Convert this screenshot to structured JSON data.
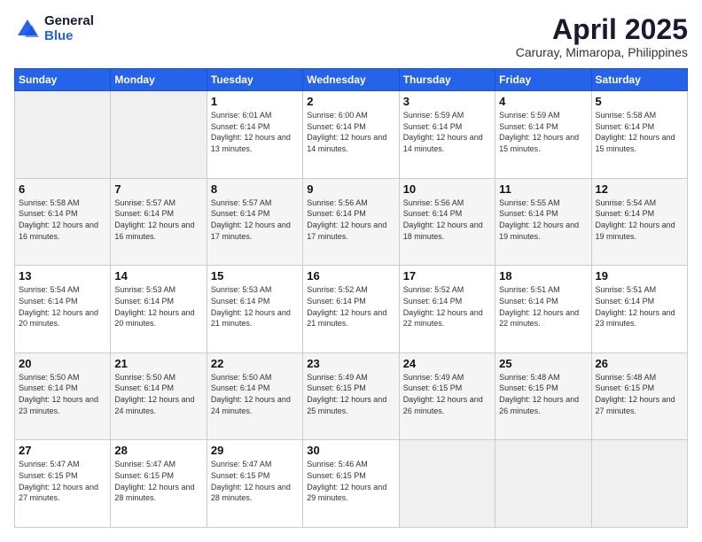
{
  "logo": {
    "general": "General",
    "blue": "Blue"
  },
  "header": {
    "month": "April 2025",
    "location": "Caruray, Mimaropa, Philippines"
  },
  "weekdays": [
    "Sunday",
    "Monday",
    "Tuesday",
    "Wednesday",
    "Thursday",
    "Friday",
    "Saturday"
  ],
  "weeks": [
    [
      {
        "day": "",
        "sunrise": "",
        "sunset": "",
        "daylight": ""
      },
      {
        "day": "",
        "sunrise": "",
        "sunset": "",
        "daylight": ""
      },
      {
        "day": "1",
        "sunrise": "Sunrise: 6:01 AM",
        "sunset": "Sunset: 6:14 PM",
        "daylight": "Daylight: 12 hours and 13 minutes."
      },
      {
        "day": "2",
        "sunrise": "Sunrise: 6:00 AM",
        "sunset": "Sunset: 6:14 PM",
        "daylight": "Daylight: 12 hours and 14 minutes."
      },
      {
        "day": "3",
        "sunrise": "Sunrise: 5:59 AM",
        "sunset": "Sunset: 6:14 PM",
        "daylight": "Daylight: 12 hours and 14 minutes."
      },
      {
        "day": "4",
        "sunrise": "Sunrise: 5:59 AM",
        "sunset": "Sunset: 6:14 PM",
        "daylight": "Daylight: 12 hours and 15 minutes."
      },
      {
        "day": "5",
        "sunrise": "Sunrise: 5:58 AM",
        "sunset": "Sunset: 6:14 PM",
        "daylight": "Daylight: 12 hours and 15 minutes."
      }
    ],
    [
      {
        "day": "6",
        "sunrise": "Sunrise: 5:58 AM",
        "sunset": "Sunset: 6:14 PM",
        "daylight": "Daylight: 12 hours and 16 minutes."
      },
      {
        "day": "7",
        "sunrise": "Sunrise: 5:57 AM",
        "sunset": "Sunset: 6:14 PM",
        "daylight": "Daylight: 12 hours and 16 minutes."
      },
      {
        "day": "8",
        "sunrise": "Sunrise: 5:57 AM",
        "sunset": "Sunset: 6:14 PM",
        "daylight": "Daylight: 12 hours and 17 minutes."
      },
      {
        "day": "9",
        "sunrise": "Sunrise: 5:56 AM",
        "sunset": "Sunset: 6:14 PM",
        "daylight": "Daylight: 12 hours and 17 minutes."
      },
      {
        "day": "10",
        "sunrise": "Sunrise: 5:56 AM",
        "sunset": "Sunset: 6:14 PM",
        "daylight": "Daylight: 12 hours and 18 minutes."
      },
      {
        "day": "11",
        "sunrise": "Sunrise: 5:55 AM",
        "sunset": "Sunset: 6:14 PM",
        "daylight": "Daylight: 12 hours and 19 minutes."
      },
      {
        "day": "12",
        "sunrise": "Sunrise: 5:54 AM",
        "sunset": "Sunset: 6:14 PM",
        "daylight": "Daylight: 12 hours and 19 minutes."
      }
    ],
    [
      {
        "day": "13",
        "sunrise": "Sunrise: 5:54 AM",
        "sunset": "Sunset: 6:14 PM",
        "daylight": "Daylight: 12 hours and 20 minutes."
      },
      {
        "day": "14",
        "sunrise": "Sunrise: 5:53 AM",
        "sunset": "Sunset: 6:14 PM",
        "daylight": "Daylight: 12 hours and 20 minutes."
      },
      {
        "day": "15",
        "sunrise": "Sunrise: 5:53 AM",
        "sunset": "Sunset: 6:14 PM",
        "daylight": "Daylight: 12 hours and 21 minutes."
      },
      {
        "day": "16",
        "sunrise": "Sunrise: 5:52 AM",
        "sunset": "Sunset: 6:14 PM",
        "daylight": "Daylight: 12 hours and 21 minutes."
      },
      {
        "day": "17",
        "sunrise": "Sunrise: 5:52 AM",
        "sunset": "Sunset: 6:14 PM",
        "daylight": "Daylight: 12 hours and 22 minutes."
      },
      {
        "day": "18",
        "sunrise": "Sunrise: 5:51 AM",
        "sunset": "Sunset: 6:14 PM",
        "daylight": "Daylight: 12 hours and 22 minutes."
      },
      {
        "day": "19",
        "sunrise": "Sunrise: 5:51 AM",
        "sunset": "Sunset: 6:14 PM",
        "daylight": "Daylight: 12 hours and 23 minutes."
      }
    ],
    [
      {
        "day": "20",
        "sunrise": "Sunrise: 5:50 AM",
        "sunset": "Sunset: 6:14 PM",
        "daylight": "Daylight: 12 hours and 23 minutes."
      },
      {
        "day": "21",
        "sunrise": "Sunrise: 5:50 AM",
        "sunset": "Sunset: 6:14 PM",
        "daylight": "Daylight: 12 hours and 24 minutes."
      },
      {
        "day": "22",
        "sunrise": "Sunrise: 5:50 AM",
        "sunset": "Sunset: 6:14 PM",
        "daylight": "Daylight: 12 hours and 24 minutes."
      },
      {
        "day": "23",
        "sunrise": "Sunrise: 5:49 AM",
        "sunset": "Sunset: 6:15 PM",
        "daylight": "Daylight: 12 hours and 25 minutes."
      },
      {
        "day": "24",
        "sunrise": "Sunrise: 5:49 AM",
        "sunset": "Sunset: 6:15 PM",
        "daylight": "Daylight: 12 hours and 26 minutes."
      },
      {
        "day": "25",
        "sunrise": "Sunrise: 5:48 AM",
        "sunset": "Sunset: 6:15 PM",
        "daylight": "Daylight: 12 hours and 26 minutes."
      },
      {
        "day": "26",
        "sunrise": "Sunrise: 5:48 AM",
        "sunset": "Sunset: 6:15 PM",
        "daylight": "Daylight: 12 hours and 27 minutes."
      }
    ],
    [
      {
        "day": "27",
        "sunrise": "Sunrise: 5:47 AM",
        "sunset": "Sunset: 6:15 PM",
        "daylight": "Daylight: 12 hours and 27 minutes."
      },
      {
        "day": "28",
        "sunrise": "Sunrise: 5:47 AM",
        "sunset": "Sunset: 6:15 PM",
        "daylight": "Daylight: 12 hours and 28 minutes."
      },
      {
        "day": "29",
        "sunrise": "Sunrise: 5:47 AM",
        "sunset": "Sunset: 6:15 PM",
        "daylight": "Daylight: 12 hours and 28 minutes."
      },
      {
        "day": "30",
        "sunrise": "Sunrise: 5:46 AM",
        "sunset": "Sunset: 6:15 PM",
        "daylight": "Daylight: 12 hours and 29 minutes."
      },
      {
        "day": "",
        "sunrise": "",
        "sunset": "",
        "daylight": ""
      },
      {
        "day": "",
        "sunrise": "",
        "sunset": "",
        "daylight": ""
      },
      {
        "day": "",
        "sunrise": "",
        "sunset": "",
        "daylight": ""
      }
    ]
  ]
}
